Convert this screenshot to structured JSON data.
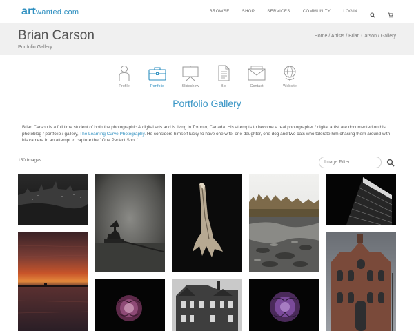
{
  "brand": {
    "logo_part1": "art",
    "logo_part2": "wanted.com",
    "accent": "#2e8fc0"
  },
  "nav": {
    "items": [
      "BROWSE",
      "SHOP",
      "SERVICES",
      "COMMUNITY",
      "LOGIN"
    ],
    "icons": [
      "search-icon",
      "cart-icon"
    ]
  },
  "header": {
    "title": "Brian Carson",
    "subtitle": "Portfolio Gallery",
    "breadcrumb": [
      "Home",
      "Artists",
      "Brian Carson",
      "Gallery"
    ],
    "breadcrumb_separator": " / "
  },
  "tabs": [
    {
      "label": "Profile",
      "icon": "person-icon",
      "active": false
    },
    {
      "label": "Portfolio",
      "icon": "briefcase-icon",
      "active": true
    },
    {
      "label": "Slideshow",
      "icon": "easel-icon",
      "active": false
    },
    {
      "label": "Bio",
      "icon": "document-icon",
      "active": false
    },
    {
      "label": "Contact",
      "icon": "envelope-icon",
      "active": false
    },
    {
      "label": "Website",
      "icon": "globe-icon",
      "active": false
    }
  ],
  "gallery": {
    "title": "Portfolio Gallery",
    "bio_before_link": "Brian Carson is a full time student of both the photographic & digital arts and is living in Toronto, Canada. His attempts to become a real photographer / digital artist are documented on his photoblog / portfolio / gallery, ",
    "bio_link": "The Learning Curve Photography",
    "bio_after_link": ". He considers himself lucky to have one wife, one daughter, one dog and two cats who tolerate him chasing them around with his camera in an attempt to capture the ' One Perfect Shot '.",
    "count": "150 Images",
    "filter_placeholder": "Image Filter"
  }
}
